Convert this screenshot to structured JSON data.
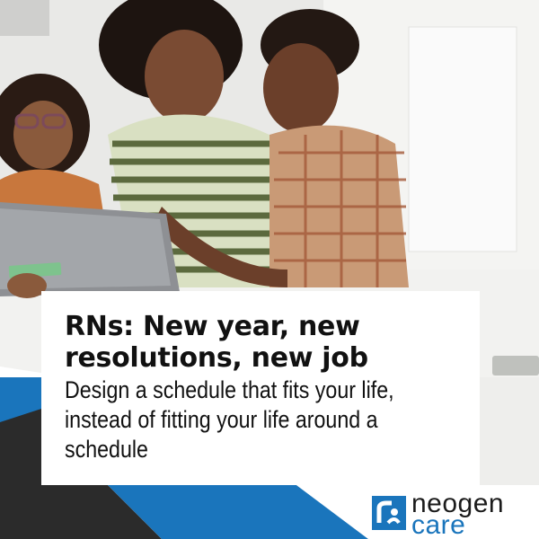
{
  "ad": {
    "headline_line1": "RNs: New year, new",
    "headline_line2": "resolutions, new job",
    "subhead_line1": "Design a schedule that fits your life,",
    "subhead_line2": "instead of fitting your life around a",
    "subhead_line3": "schedule"
  },
  "brand": {
    "name_top": "neogen",
    "name_bottom": "care",
    "logo_icon": "neogen-mark-icon"
  },
  "photo": {
    "description_icon": "family-with-laptop-photo"
  },
  "colors": {
    "brand_blue": "#1a75bc",
    "band_dark": "#2b2b2b",
    "text": "#111111"
  }
}
